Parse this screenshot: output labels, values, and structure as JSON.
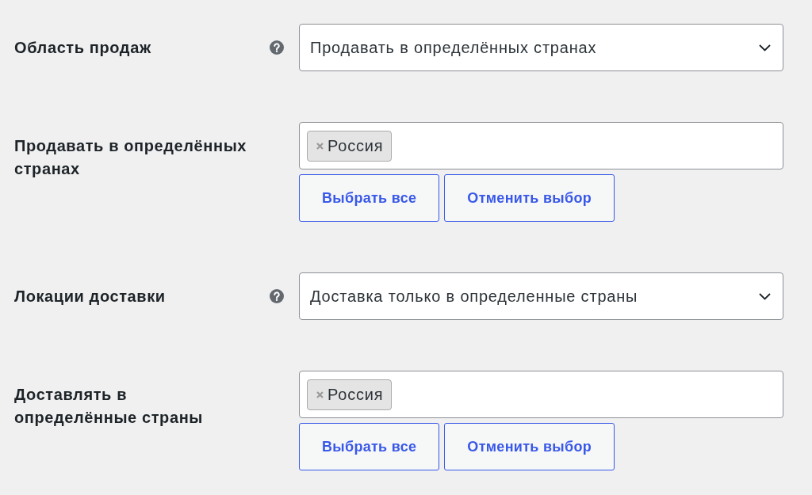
{
  "fields": [
    {
      "kind": "select",
      "label": "Область продаж",
      "help": true,
      "value": "Продавать в определённых странах"
    },
    {
      "kind": "multiselect",
      "label": "Продавать в определённых странах",
      "help": false,
      "tags": [
        {
          "label": "Россия"
        }
      ],
      "buttons": [
        {
          "label": "Выбрать все"
        },
        {
          "label": "Отменить выбор"
        }
      ]
    },
    {
      "kind": "select",
      "label": "Локации доставки",
      "help": true,
      "value": "Доставка только в определенные страны"
    },
    {
      "kind": "multiselect",
      "label": "Доставлять в определённые страны",
      "help": false,
      "tags": [
        {
          "label": "Россия"
        }
      ],
      "buttons": [
        {
          "label": "Выбрать все"
        },
        {
          "label": "Отменить выбор"
        }
      ]
    }
  ]
}
